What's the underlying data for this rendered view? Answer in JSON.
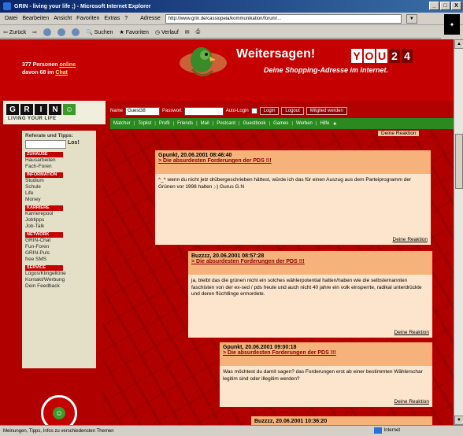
{
  "window": {
    "title": "GRIN - living your life ;) - Microsoft Internet Explorer",
    "buttons": [
      "_",
      "□",
      "X"
    ]
  },
  "menu": {
    "items": [
      "Datei",
      "Bearbeiten",
      "Ansicht",
      "Favoriten",
      "Extras",
      "?"
    ],
    "address_label": "Adresse",
    "address_value": "http://www.grin.de/cassiopeia/kommunikation/forum/...",
    "go_label": "▼"
  },
  "toolbar": {
    "back": "Zurück",
    "search": "Suchen",
    "favorites": "Favoriten",
    "history": "Verlauf"
  },
  "banner": {
    "online_count": "377 Personen",
    "online_word": "online",
    "online_line2_prefix": "davon 68 im",
    "online_chat": "Chat",
    "weitersagen": "Weitersagen!",
    "slogan": "Deine Shopping-Adresse im Internet.",
    "you24_letters": [
      "Y",
      "O",
      "U",
      "2",
      "4"
    ]
  },
  "grin": {
    "letters": [
      "G",
      "R",
      "I",
      "N",
      "☺"
    ],
    "tagline": "LIVING YOUR LIFE"
  },
  "login": {
    "name_label": "Name",
    "name_value": "Guest38",
    "password_label": "Passwort",
    "autologin_label": "Auto-Login",
    "login_btn": "Login",
    "logout_btn": "Logout",
    "member_btn": "Mitglied werden"
  },
  "navbar": {
    "items": [
      "Matcher",
      "Toplist",
      "Profil",
      "Friends",
      "Mail",
      "Postcard",
      "Guestbook",
      "Games",
      "Werben",
      "Hilfe"
    ]
  },
  "sidebar": {
    "title": "Referate und Tipps:",
    "search_btn": "Los!",
    "sections": [
      {
        "title": "ZUHAUSE",
        "items": [
          "Hausarbeiten",
          "Fach-Foren"
        ]
      },
      {
        "title": "INFORMATION",
        "items": [
          "Studium",
          "Schule",
          "Life",
          "Money"
        ]
      },
      {
        "title": "KARRIERE",
        "items": [
          "Karrierepool",
          "Jobtipps",
          "Job-Talk"
        ]
      },
      {
        "title": "NETWORK",
        "items": [
          "GRIN-Chat",
          "Fun-Foren",
          "GRIN-Puls",
          "free SMS"
        ]
      },
      {
        "title": "SERVICE",
        "items": [
          "Logos/Klingeltöne",
          "Kontakt/Werbung",
          "Dein Feedback"
        ]
      }
    ]
  },
  "posts": {
    "top_answer": "Deine Reaktion",
    "list": [
      {
        "author": "Gpunkt, 20.06.2001 08:46:40",
        "subject": "> Die absurdesten Forderungen der PDS !!!",
        "body": "^_^ wenn du nicht jetz drübergeschrieben hättest, würde ich das für einen Auszug aus dem Parteiprogramm der Grünen vor 1998 halten ;-) Gurus G.N",
        "answer": "Deine Reaktion"
      },
      {
        "author": "Buzzzz, 20.06.2001 08:57:28",
        "subject": "> Die absurdesten Forderungen der PDS !!!",
        "body": "ja, bleibt das die grünen nicht ein solches wählerpotential hatten/haben wie die selbsternannten faschisten von der ex-sed / pds heute und auch nicht 40 jahre ein volk einsperrte, radikal unterdrückte und deren flüchtlinge ermordete.",
        "answer": "Deine Reaktion"
      },
      {
        "author": "Gpunkt, 20.06.2001 09:00:18",
        "subject": "> Die absurdesten Forderungen der PDS !!!",
        "body": "Was möchtest du damit sagen? das Forderungen erst ab einer bestimmten Wählerschar legitim sind oder illegitim werden?",
        "answer": "Deine Reaktion"
      },
      {
        "author": "Buzzzz, 20.06.2001 10:36:20",
        "subject": "",
        "body": "",
        "answer": ""
      }
    ]
  },
  "status": {
    "text": "Meinungen, Tipps, Infos zu verschiedensten Themen",
    "zone": "Internet"
  }
}
